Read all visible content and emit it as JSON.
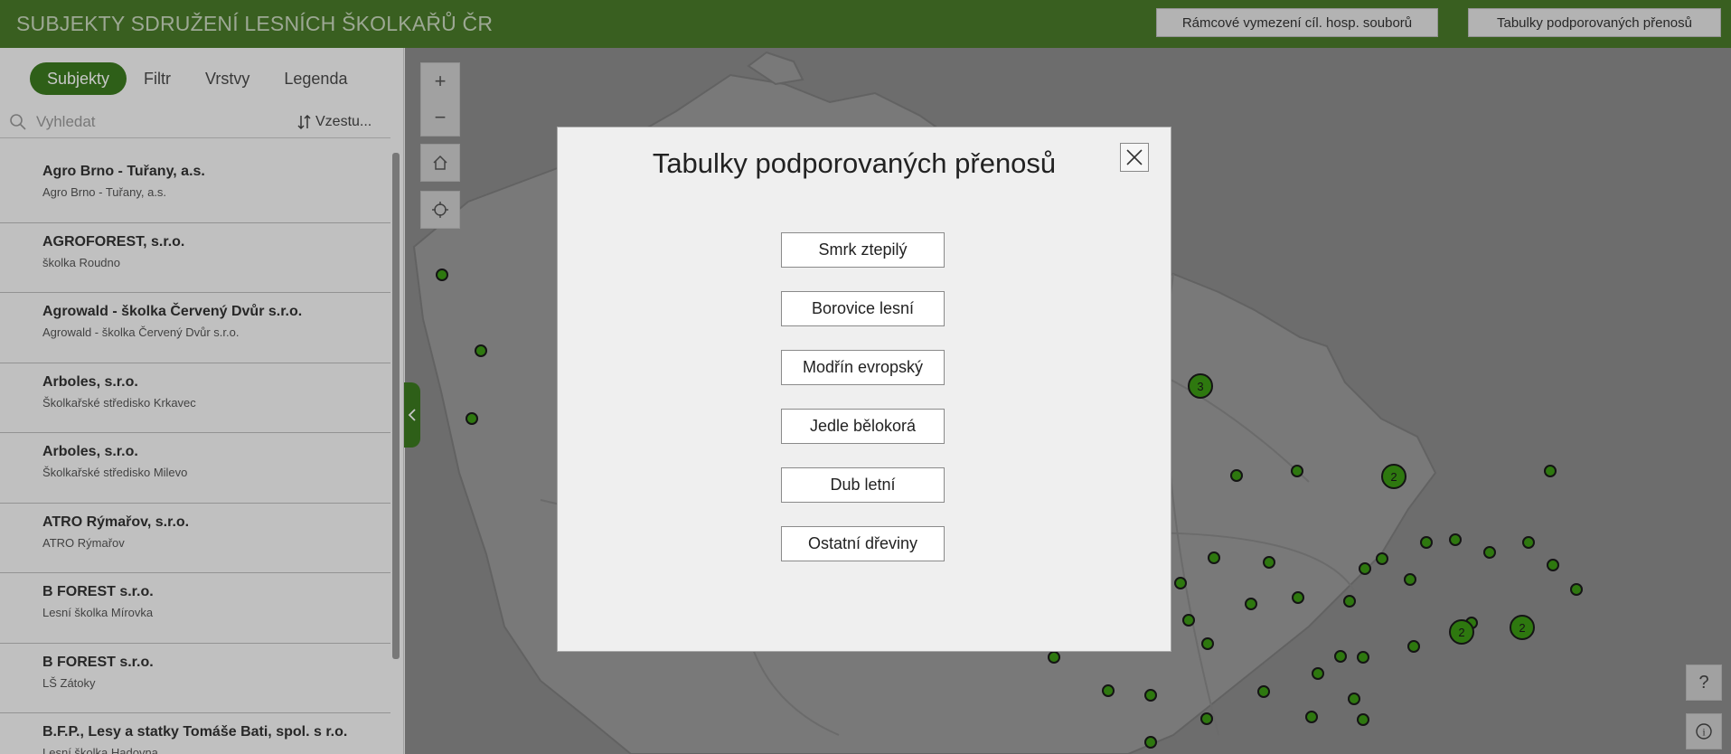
{
  "header": {
    "title": "SUBJEKTY SDRUŽENÍ LESNÍCH ŠKOLKAŘŮ ČR",
    "button_frame": "Rámcové vymezení cíl. hosp. souborů",
    "button_tables": "Tabulky podporovaných přenosů"
  },
  "sidebar": {
    "tabs": [
      {
        "label": "Subjekty",
        "active": true
      },
      {
        "label": "Filtr",
        "active": false
      },
      {
        "label": "Vrstvy",
        "active": false
      },
      {
        "label": "Legenda",
        "active": false
      }
    ],
    "search_placeholder": "Vyhledat",
    "sort_label": "Vzestu...",
    "items": [
      {
        "title": "Agro Brno - Tuřany, a.s.",
        "subtitle": "Agro Brno - Tuřany, a.s."
      },
      {
        "title": "AGROFOREST, s.r.o.",
        "subtitle": "školka Roudno"
      },
      {
        "title": "Agrowald - školka Červený Dvůr s.r.o.",
        "subtitle": "Agrowald - školka Červený Dvůr s.r.o."
      },
      {
        "title": "Arboles, s.r.o.",
        "subtitle": "Školkařské středisko Krkavec"
      },
      {
        "title": "Arboles, s.r.o.",
        "subtitle": "Školkařské středisko Milevo"
      },
      {
        "title": "ATRO Rýmařov, s.r.o.",
        "subtitle": "ATRO Rýmařov"
      },
      {
        "title": "B FOREST s.r.o.",
        "subtitle": "Lesní školka Mírovka"
      },
      {
        "title": "B FOREST s.r.o.",
        "subtitle": "LŠ Zátoky"
      },
      {
        "title": "B.F.P., Lesy a statky Tomáše Bati, spol. s r.o.",
        "subtitle": "Lesní školka Hadovna"
      }
    ]
  },
  "map": {
    "zoom_in": "+",
    "zoom_out": "−",
    "help": "?",
    "info": "i",
    "clusters": [
      {
        "label": "3"
      },
      {
        "label": "2"
      },
      {
        "label": "2"
      },
      {
        "label": "2"
      }
    ],
    "colors": {
      "marker": "#3c9a14",
      "header": "#4a7a2a",
      "accent": "#3b7a1f"
    }
  },
  "modal": {
    "title": "Tabulky podporovaných přenosů",
    "buttons": [
      "Smrk ztepilý",
      "Borovice lesní",
      "Modřín evropský",
      "Jedle bělokorá",
      "Dub letní",
      "Ostatní dřeviny"
    ]
  }
}
